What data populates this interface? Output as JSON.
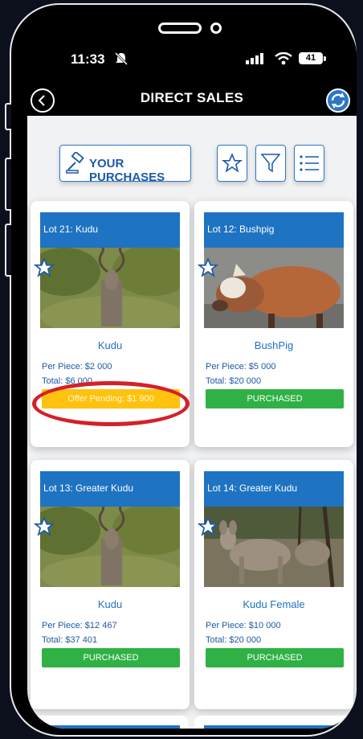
{
  "status_bar": {
    "time": "11:33",
    "battery": "41"
  },
  "header": {
    "title": "DIRECT SALES"
  },
  "toolbar": {
    "purchases_label": "YOUR PURCHASES"
  },
  "colors": {
    "brand_blue": "#1e73c2",
    "purchased_green": "#2fb145",
    "pending_yellow": "#ffc20e",
    "highlight_red": "#d4202a"
  },
  "lots": [
    {
      "title": "Lot 21: Kudu",
      "name": "Kudu",
      "per_piece": "Per Piece: $2 000",
      "total": "Total: $6 000",
      "status": "Offer Pending: $1 900",
      "image": "kudu-bull-photo"
    },
    {
      "title": "Lot 12: Bushpig",
      "name": "BushPig",
      "per_piece": "Per Piece: $5 000",
      "total": "Total: $20 000",
      "status": "PURCHASED",
      "image": "bushpig-photo"
    },
    {
      "title": "Lot 13: Greater Kudu",
      "name": "Kudu",
      "per_piece": "Per Piece: $12 467",
      "total": "Total: $37 401",
      "status": "PURCHASED",
      "image": "kudu-bull-photo"
    },
    {
      "title": "Lot 14: Greater Kudu",
      "name": "Kudu Female",
      "per_piece": "Per Piece: $10 000",
      "total": "Total: $20 000",
      "status": "PURCHASED",
      "image": "kudu-female-photo"
    }
  ]
}
